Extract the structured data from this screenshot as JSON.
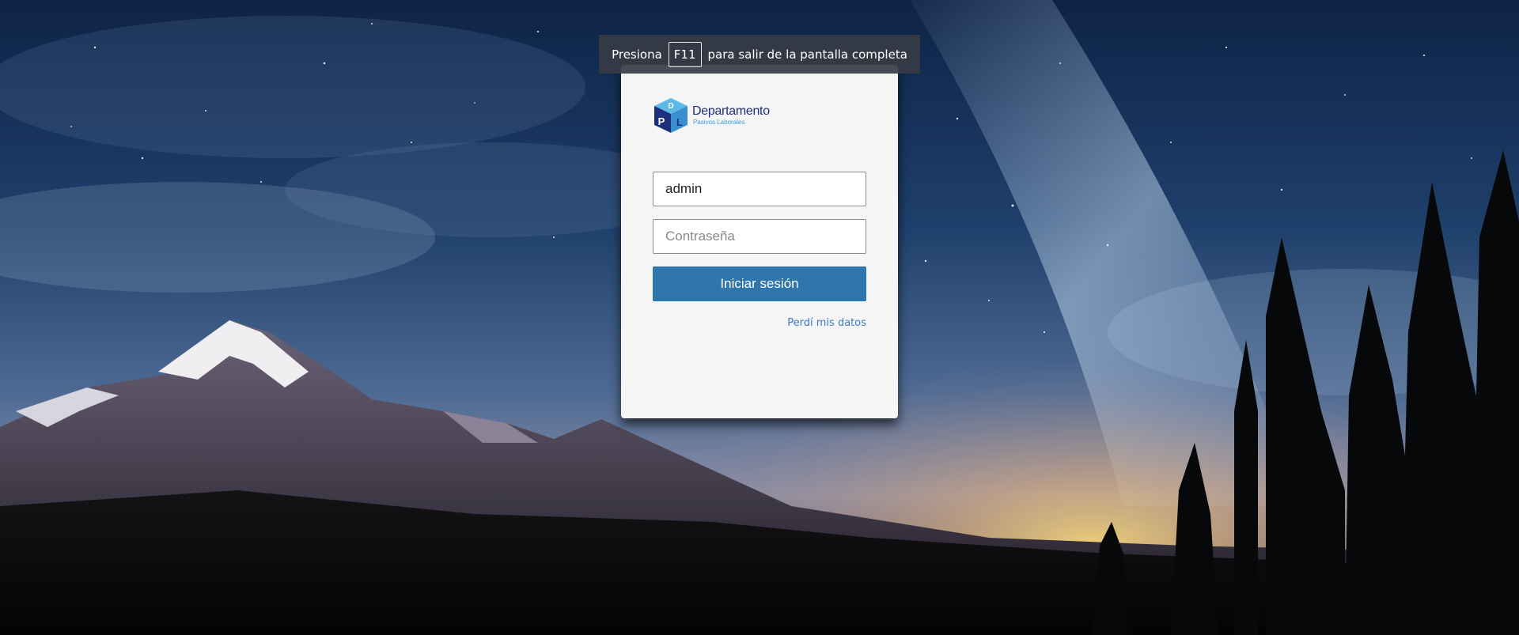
{
  "fullscreen_notice": {
    "before": "Presiona",
    "key": "F11",
    "after": "para salir de la pantalla completa"
  },
  "logo": {
    "icon": "pdl-cube-logo",
    "letters": [
      "D",
      "P",
      "L"
    ],
    "title": "Departamento",
    "subtitle": "Pasivos Laborales",
    "colors": {
      "title": "#1d2f7a",
      "subtitle": "#3b9fd8",
      "cube_top": "#5bb8e8",
      "cube_left": "#1d2f7a",
      "cube_right": "#3a8fd0"
    }
  },
  "login": {
    "username_value": "admin",
    "password_placeholder": "Contraseña",
    "submit_label": "Iniciar sesión",
    "forgot_label": "Perdí mis datos"
  },
  "colors": {
    "button": "#2f76ad",
    "link": "#3a7bc8",
    "card": "#f5f5f5"
  }
}
